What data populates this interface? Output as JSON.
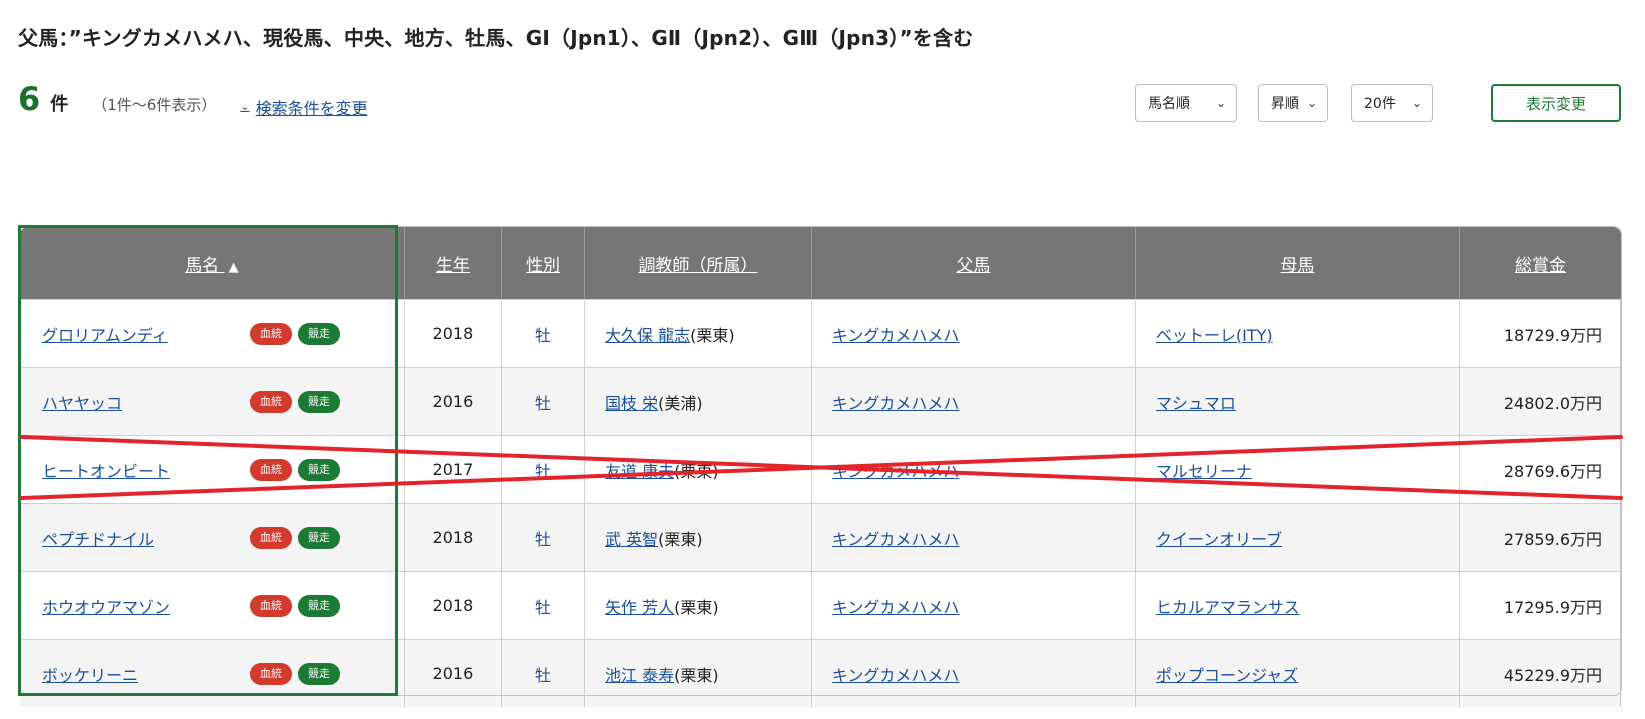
{
  "search": {
    "title": "父馬：”キングカメハメハ、現役馬、中央、地方、牡馬、GⅠ（Jpn1）、GⅡ（Jpn2）、GⅢ（Jpn3）”を含む",
    "count": "6",
    "count_unit": "件",
    "range_text": "（1件～6件表示）",
    "change_link": "検索条件を変更"
  },
  "controls": {
    "sort_field": "馬名順",
    "sort_order": "昇順",
    "per_page": "20件",
    "apply_button": "表示変更"
  },
  "table": {
    "headers": {
      "name": "馬名",
      "sort_indicator": "▲",
      "birth_year": "生年",
      "sex": "性別",
      "trainer": "調教師（所属）",
      "sire": "父馬",
      "dam": "母馬",
      "earnings": "総賞金"
    },
    "badge_pedigree": "血統",
    "badge_race": "競走",
    "rows": [
      {
        "name": "グロリアムンディ",
        "year": "2018",
        "sex": "牡",
        "trainer": "大久保 龍志",
        "affiliation": "(栗東)",
        "sire": "キングカメハメハ",
        "dam": "ベットーレ(ITY)",
        "earnings": "18729.9万円"
      },
      {
        "name": "ハヤヤッコ",
        "year": "2016",
        "sex": "牡",
        "trainer": "国枝 栄",
        "affiliation": "(美浦)",
        "sire": "キングカメハメハ",
        "dam": "マシュマロ",
        "earnings": "24802.0万円"
      },
      {
        "name": "ヒートオンビート",
        "year": "2017",
        "sex": "牡",
        "trainer": "友道 康夫",
        "affiliation": "(栗東)",
        "sire": "キングカメハメハ",
        "dam": "マルセリーナ",
        "earnings": "28769.6万円"
      },
      {
        "name": "ペプチドナイル",
        "year": "2018",
        "sex": "牡",
        "trainer": "武 英智",
        "affiliation": "(栗東)",
        "sire": "キングカメハメハ",
        "dam": "クイーンオリーブ",
        "earnings": "27859.6万円"
      },
      {
        "name": "ホウオウアマゾン",
        "year": "2018",
        "sex": "牡",
        "trainer": "矢作 芳人",
        "affiliation": "(栗東)",
        "sire": "キングカメハメハ",
        "dam": "ヒカルアマランサス",
        "earnings": "17295.9万円"
      },
      {
        "name": "ボッケリーニ",
        "year": "2016",
        "sex": "牡",
        "trainer": "池江 泰寿",
        "affiliation": "(栗東)",
        "sire": "キングカメハメハ",
        "dam": "ポップコーンジャズ",
        "earnings": "45229.9万円"
      }
    ]
  },
  "colors": {
    "accent_green": "#1e7a35",
    "header_gray": "#767676",
    "link_blue": "#1a4f9c",
    "badge_red": "#d23a2e",
    "annotation_red": "#e3242b"
  }
}
